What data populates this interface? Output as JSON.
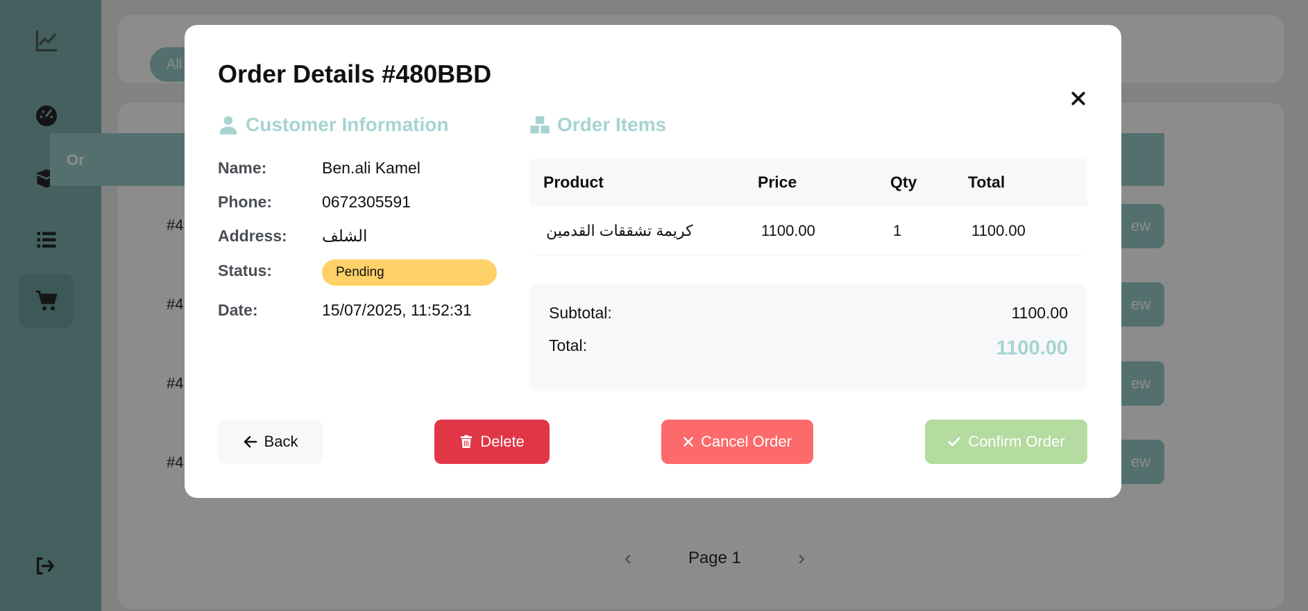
{
  "background": {
    "filter_all_label": "All",
    "table_header_label": "Or",
    "row_ids": [
      "#4",
      "#4",
      "#4",
      "#4"
    ],
    "view_label": "ew",
    "pagination": {
      "page_label": "Page 1"
    }
  },
  "modal": {
    "title": "Order Details #480BBD",
    "customer": {
      "section_title": "Customer Information",
      "name_label": "Name:",
      "name_value": "Ben.ali Kamel",
      "phone_label": "Phone:",
      "phone_value": "0672305591",
      "address_label": "Address:",
      "address_value": "الشلف",
      "status_label": "Status:",
      "status_value": "Pending",
      "date_label": "Date:",
      "date_value": "15/07/2025, 11:52:31"
    },
    "items": {
      "section_title": "Order Items",
      "columns": [
        "Product",
        "Price",
        "Qty",
        "Total"
      ],
      "rows": [
        {
          "product": "كريمة تشققات القدمين",
          "price": "1100.00",
          "qty": "1",
          "total": "1100.00"
        }
      ]
    },
    "totals": {
      "subtotal_label": "Subtotal:",
      "subtotal_value": "1100.00",
      "total_label": "Total:",
      "total_value": "1100.00"
    },
    "actions": {
      "back_label": "Back",
      "delete_label": "Delete",
      "cancel_label": "Cancel Order",
      "confirm_label": "Confirm Order"
    }
  },
  "colors": {
    "accent": "#a6d4d1",
    "sidebar": "#6fa8a5",
    "status_pending": "#fdd168",
    "delete": "#e03646",
    "cancel": "#fc6a6c",
    "confirm": "#b4dba0"
  }
}
